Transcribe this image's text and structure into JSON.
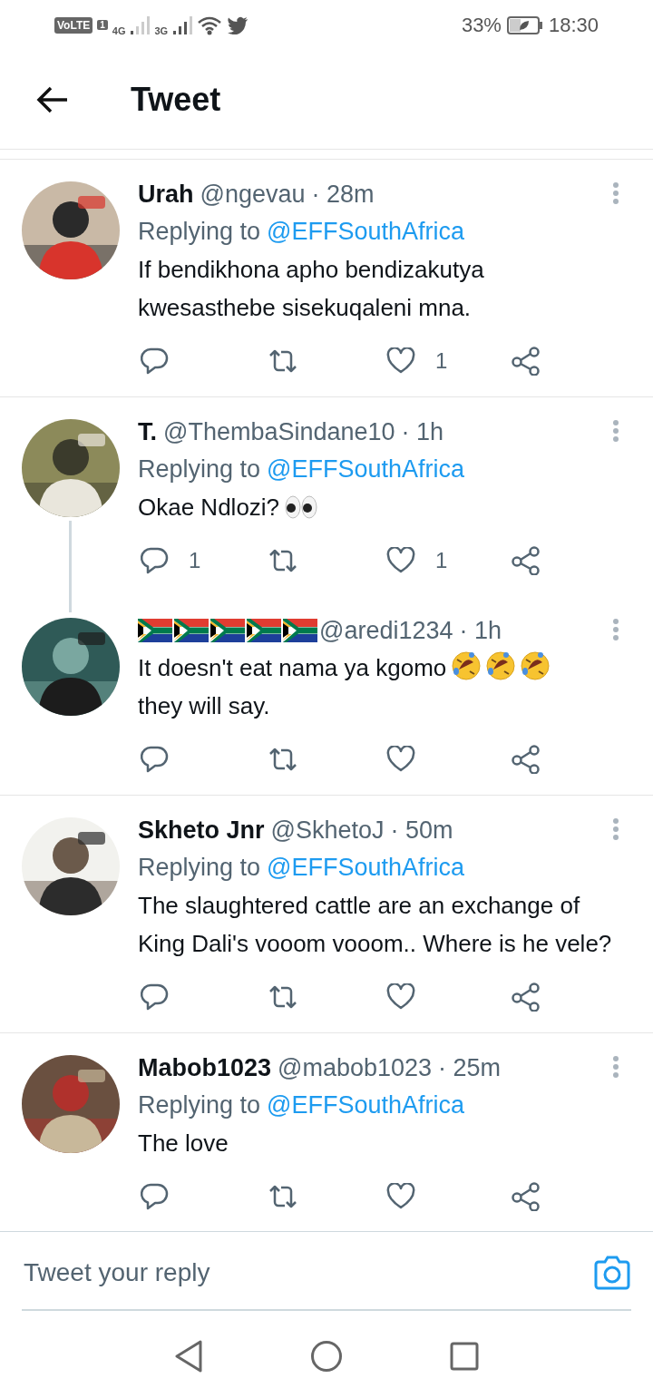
{
  "status_bar": {
    "volte": "VoLTE",
    "sim": "1",
    "network_1": "4G",
    "network_2": "3G",
    "battery": "33%",
    "time": "18:30"
  },
  "header": {
    "title": "Tweet"
  },
  "tweets": [
    {
      "name": "Urah",
      "handle": "@ngevau",
      "time": "· 28m",
      "replying_label": "Replying to",
      "replying_to": "@EFFSouthAfrica",
      "text": "If bendikhona apho bendizakutya kwesasthebe sisekuqaleni mna.",
      "likes": "1",
      "thread_next": false
    },
    {
      "name": "T.",
      "handle": "@ThembaSindane10",
      "time": "· 1h",
      "replying_label": "Replying to",
      "replying_to": "@EFFSouthAfrica",
      "text": "Okae Ndlozi?",
      "text_emoji": [
        {
          "kind": "eyes"
        }
      ],
      "replies": "1",
      "likes": "1",
      "thread_next": true
    },
    {
      "name_emoji": [
        {
          "kind": "flag"
        },
        {
          "kind": "flag"
        },
        {
          "kind": "flag"
        },
        {
          "kind": "flag"
        },
        {
          "kind": "flag"
        }
      ],
      "handle": "@aredi1234",
      "time": "· 1h",
      "text": "It doesn't eat nama ya kgomo",
      "text_emoji": [
        {
          "kind": "laugh"
        },
        {
          "kind": "laugh"
        },
        {
          "kind": "laugh"
        }
      ],
      "text_after": "they will say.",
      "thread_next": false
    },
    {
      "name": "Skheto Jnr",
      "handle": "@SkhetoJ",
      "time": "· 50m",
      "replying_label": "Replying to",
      "replying_to": "@EFFSouthAfrica",
      "text": "The slaughtered cattle are an exchange of King Dali's vooom vooom.. Where is he vele?",
      "thread_next": false
    },
    {
      "name": "Mabob1023",
      "handle": "@mabob1023",
      "time": "· 25m",
      "replying_label": "Replying to",
      "replying_to": "@EFFSouthAfrica",
      "text": "The love",
      "thread_next": false
    }
  ],
  "reply_bar": {
    "placeholder": "Tweet your reply"
  }
}
